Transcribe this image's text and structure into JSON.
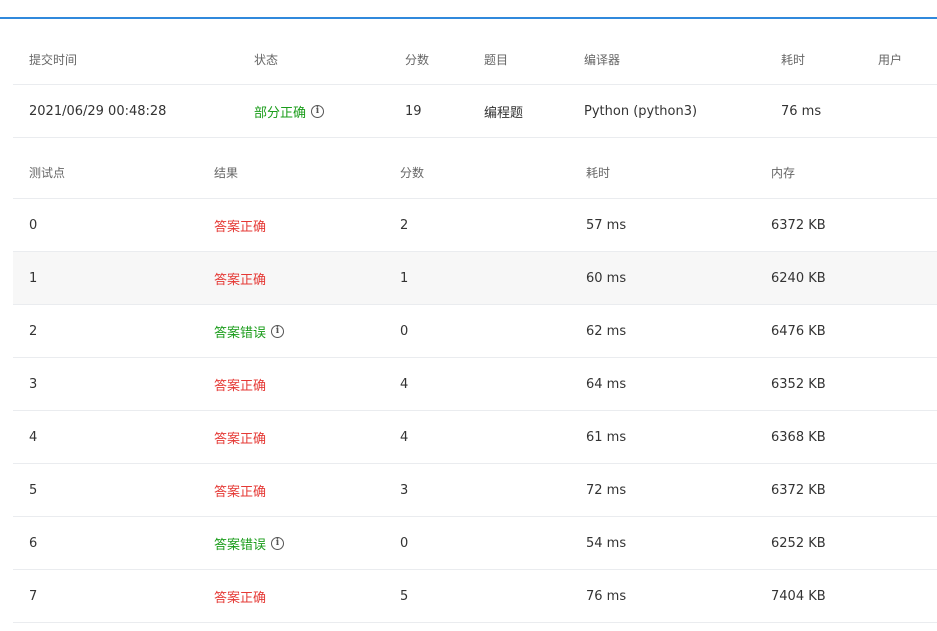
{
  "colors": {
    "accent": "#3089dc",
    "correct": "#e53935",
    "wrong": "#1a9c1a",
    "partial": "#1a9c1a"
  },
  "submission": {
    "headers": {
      "time": "提交时间",
      "status": "状态",
      "score": "分数",
      "problem": "题目",
      "compiler": "编译器",
      "elapsed": "耗时",
      "user": "用户"
    },
    "row": {
      "time": "2021/06/29 00:48:28",
      "status": "部分正确",
      "score": "19",
      "problem": "编程题",
      "compiler": "Python (python3)",
      "elapsed": "76 ms",
      "user": ""
    }
  },
  "results": {
    "headers": {
      "case": "测试点",
      "result": "结果",
      "score": "分数",
      "elapsed": "耗时",
      "memory": "内存"
    },
    "rows": [
      {
        "case": "0",
        "result": "答案正确",
        "ok": true,
        "score": "2",
        "elapsed": "57 ms",
        "memory": "6372 KB"
      },
      {
        "case": "1",
        "result": "答案正确",
        "ok": true,
        "score": "1",
        "elapsed": "60 ms",
        "memory": "6240 KB"
      },
      {
        "case": "2",
        "result": "答案错误",
        "ok": false,
        "score": "0",
        "elapsed": "62 ms",
        "memory": "6476 KB"
      },
      {
        "case": "3",
        "result": "答案正确",
        "ok": true,
        "score": "4",
        "elapsed": "64 ms",
        "memory": "6352 KB"
      },
      {
        "case": "4",
        "result": "答案正确",
        "ok": true,
        "score": "4",
        "elapsed": "61 ms",
        "memory": "6368 KB"
      },
      {
        "case": "5",
        "result": "答案正确",
        "ok": true,
        "score": "3",
        "elapsed": "72 ms",
        "memory": "6372 KB"
      },
      {
        "case": "6",
        "result": "答案错误",
        "ok": false,
        "score": "0",
        "elapsed": "54 ms",
        "memory": "6252 KB"
      },
      {
        "case": "7",
        "result": "答案正确",
        "ok": true,
        "score": "5",
        "elapsed": "76 ms",
        "memory": "7404 KB"
      }
    ]
  },
  "icons": {
    "info": "info-circle-icon",
    "info_glyph": "i"
  }
}
